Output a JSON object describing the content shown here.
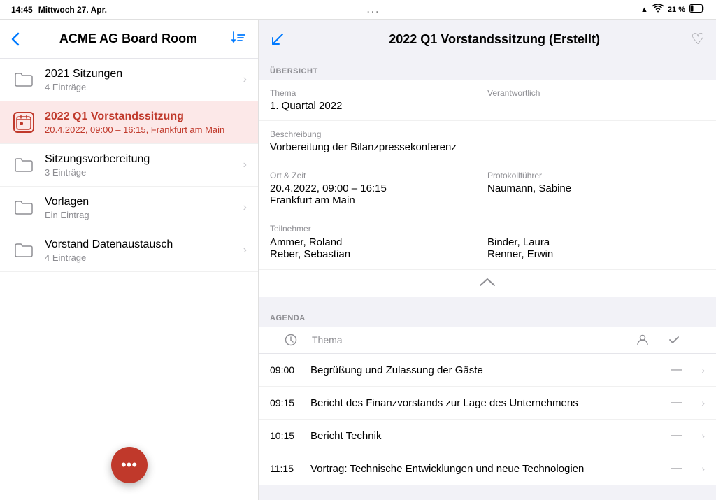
{
  "statusBar": {
    "time": "14:45",
    "date": "Mittwoch 27. Apr.",
    "dots": "...",
    "signal": "▲",
    "wifi": "wifi",
    "battery": "21 %"
  },
  "leftPanel": {
    "backLabel": "‹",
    "title": "ACME AG Board Room",
    "sortIcon": "⇅",
    "listItems": [
      {
        "type": "folder",
        "title": "2021 Sitzungen",
        "subtitle": "4 Einträge",
        "active": false
      },
      {
        "type": "calendar",
        "title": "2022 Q1 Vorstandssitzung",
        "subtitle": "20.4.2022, 09:00 – 16:15, Frankfurt am Main",
        "active": true
      },
      {
        "type": "folder",
        "title": "Sitzungsvorbereitung",
        "subtitle": "3 Einträge",
        "active": false
      },
      {
        "type": "folder",
        "title": "Vorlagen",
        "subtitle": "Ein Eintrag",
        "active": false
      },
      {
        "type": "folder",
        "title": "Vorstand Datenaustausch",
        "subtitle": "4 Einträge",
        "active": false
      }
    ],
    "fabLabel": "•••"
  },
  "rightPanel": {
    "arrowIcon": "↖",
    "title": "2022 Q1 Vorstandssitzung (Erstellt)",
    "heartIcon": "♡",
    "overview": {
      "sectionLabel": "ÜBERSICHT",
      "themaLabel": "Thema",
      "themaValue": "1. Quartal 2022",
      "verantwortlichLabel": "Verantwortlich",
      "verantwortlichValue": "",
      "beschreibungLabel": "Beschreibung",
      "beschreibungValue": "Vorbereitung der Bilanzpressekonferenz",
      "ortZeitLabel": "Ort & Zeit",
      "ortZeitValue1": "20.4.2022, 09:00 – 16:15",
      "ortZeitValue2": "Frankfurt am Main",
      "protokollfuehrerLabel": "Protokollführer",
      "protokollfuehrerValue": "Naumann, Sabine",
      "teilnehmerLabel": "Teilnehmer",
      "teilnehmer": [
        {
          "col1": "Ammer, Roland",
          "col2": "Binder, Laura"
        },
        {
          "col1": "Reber, Sebastian",
          "col2": "Renner, Erwin"
        }
      ],
      "collapseIcon": "⌃"
    },
    "agenda": {
      "sectionLabel": "AGENDA",
      "headerTime": "⏱",
      "headerThema": "Thema",
      "headerPerson": "👤",
      "headerCheck": "✓",
      "items": [
        {
          "time": "09:00",
          "title": "Begrüßung und Zulassung der Gäste",
          "dash": "—"
        },
        {
          "time": "09:15",
          "title": "Bericht des Finanzvorstands zur Lage des Unternehmens",
          "dash": "—"
        },
        {
          "time": "10:15",
          "title": "Bericht Technik",
          "dash": "—"
        },
        {
          "time": "11:15",
          "title": "Vortrag: Technische Entwicklungen und neue Technologien",
          "dash": "—"
        }
      ]
    }
  }
}
